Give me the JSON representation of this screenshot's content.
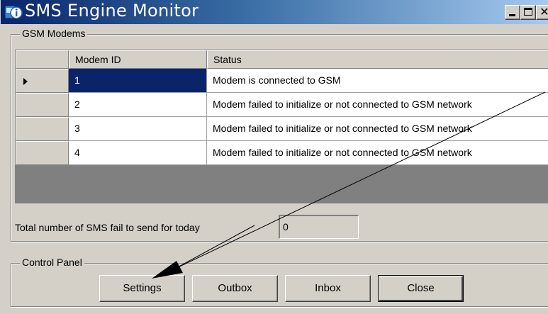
{
  "window": {
    "title": "SMS Engine Monitor",
    "icon": "app-info-icon",
    "controls": [
      "minimize-icon",
      "maximize-icon",
      "close-icon"
    ]
  },
  "gsm_modems": {
    "group_label": "GSM Modems",
    "columns": [
      "Modem ID",
      "Status"
    ],
    "rows": [
      {
        "id": "1",
        "status": "Modem is connected to GSM",
        "selected": true
      },
      {
        "id": "2",
        "status": "Modem failed to initialize or not connected to GSM network",
        "selected": false
      },
      {
        "id": "3",
        "status": "Modem failed to initialize or not connected to GSM network",
        "selected": false
      },
      {
        "id": "4",
        "status": "Modem failed to initialize or not connected to GSM network",
        "selected": false
      }
    ],
    "fail_label": "Total number of SMS fail to send for today",
    "fail_value": "0"
  },
  "control_panel": {
    "group_label": "Control Panel",
    "buttons": {
      "settings": "Settings",
      "outbox": "Outbox",
      "inbox": "Inbox",
      "close": "Close"
    }
  },
  "colors": {
    "selection": "#0a246a",
    "face": "#d4d0c8",
    "grid_background": "#808080"
  }
}
